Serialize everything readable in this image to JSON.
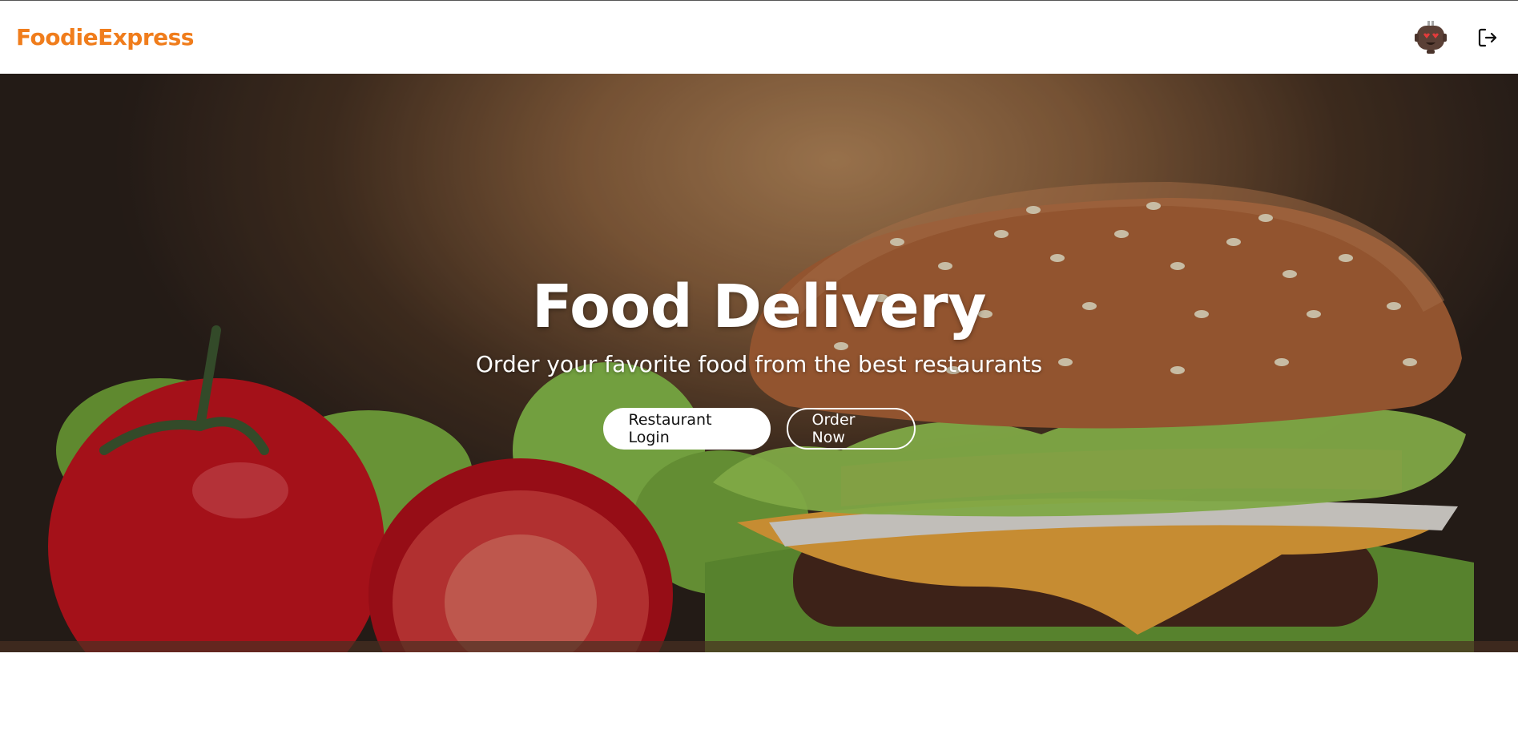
{
  "header": {
    "brand": "FoodieExpress",
    "brand_color": "#f07d1c",
    "avatar_icon": "robot-avatar-icon",
    "logout_icon": "logout-icon"
  },
  "hero": {
    "title": "Food Delivery",
    "subtitle": "Order your favorite food from the best restaurants",
    "primary_button": "Restaurant Login",
    "secondary_button": "Order Now",
    "background_image": "burger-and-tomatoes-photo"
  }
}
